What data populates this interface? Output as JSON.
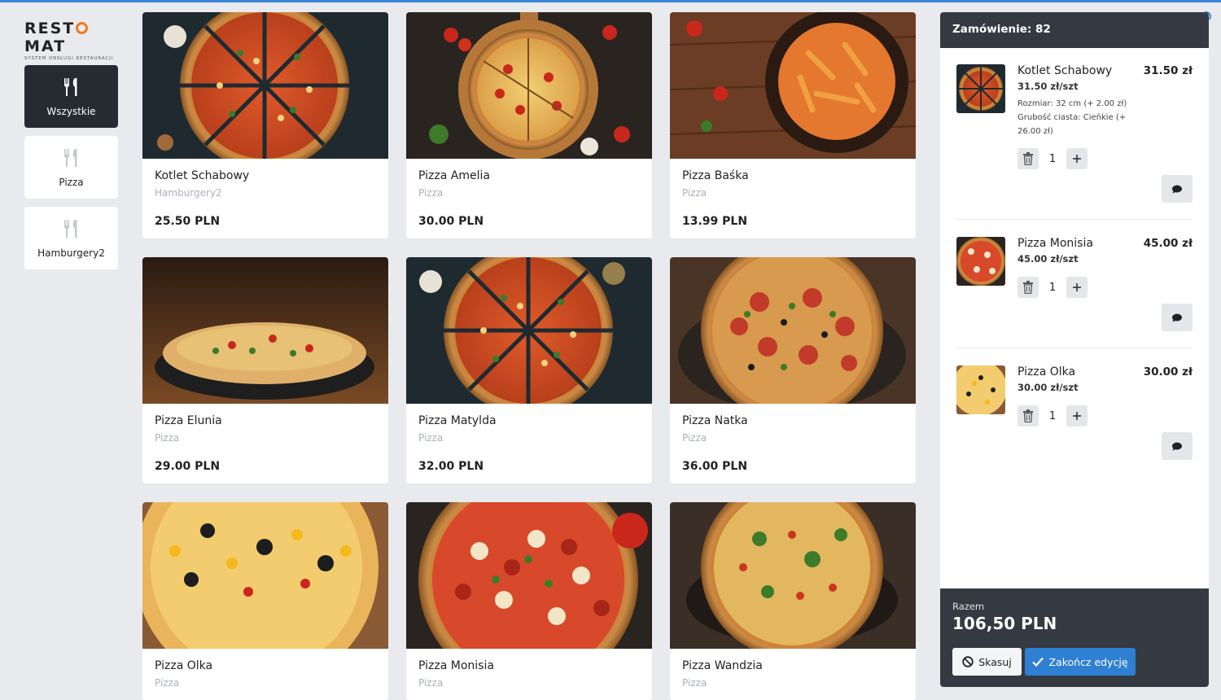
{
  "brand": {
    "name_left": "REST",
    "name_right": "MAT",
    "tagline": "SYSTEM OBSŁUGI RESTAURACJI"
  },
  "categories": [
    {
      "label": "Wszystkie",
      "icon": "cutlery-icon",
      "active": true
    },
    {
      "label": "Pizza",
      "icon": "cutlery-icon",
      "active": false
    },
    {
      "label": "Hamburgery2",
      "icon": "cutlery-icon",
      "active": false
    }
  ],
  "products": [
    {
      "name": "Kotlet Schabowy",
      "category": "Hamburgery2",
      "price": "25.50 PLN"
    },
    {
      "name": "Pizza Amelia",
      "category": "Pizza",
      "price": "30.00 PLN"
    },
    {
      "name": "Pizza Baśka",
      "category": "Pizza",
      "price": "13.99 PLN"
    },
    {
      "name": "Pizza Elunia",
      "category": "Pizza",
      "price": "29.00 PLN"
    },
    {
      "name": "Pizza Matylda",
      "category": "Pizza",
      "price": "32.00 PLN"
    },
    {
      "name": "Pizza Natka",
      "category": "Pizza",
      "price": "36.00 PLN"
    },
    {
      "name": "Pizza Olka",
      "category": "Pizza",
      "price": ""
    },
    {
      "name": "Pizza Monisia",
      "category": "Pizza",
      "price": ""
    },
    {
      "name": "Pizza Wandzia",
      "category": "Pizza",
      "price": ""
    }
  ],
  "order": {
    "title": "Zamówienie: 82",
    "items": [
      {
        "name": "Kotlet Schabowy",
        "total": "31.50 zł",
        "unit_price": "31.50 zł/szt",
        "options": [
          "Rozmiar: 32 cm (+ 2.00 zł)",
          "Grubość ciasta: Cieńkie (+ 26.00 zł)"
        ],
        "qty": "1"
      },
      {
        "name": "Pizza Monisia",
        "total": "45.00 zł",
        "unit_price": "45.00 zł/szt",
        "options": [],
        "qty": "1"
      },
      {
        "name": "Pizza Olka",
        "total": "30.00 zł",
        "unit_price": "30.00 zł/szt",
        "options": [],
        "qty": "1"
      }
    ],
    "sum_label": "Razem",
    "sum_value": "106,50 PLN",
    "cancel_label": "Skasuj",
    "finish_label": "Zakończ edycję"
  },
  "colors": {
    "accent": "#2f80d3",
    "dark": "#353a42",
    "logo_orange": "#f07a1c"
  }
}
